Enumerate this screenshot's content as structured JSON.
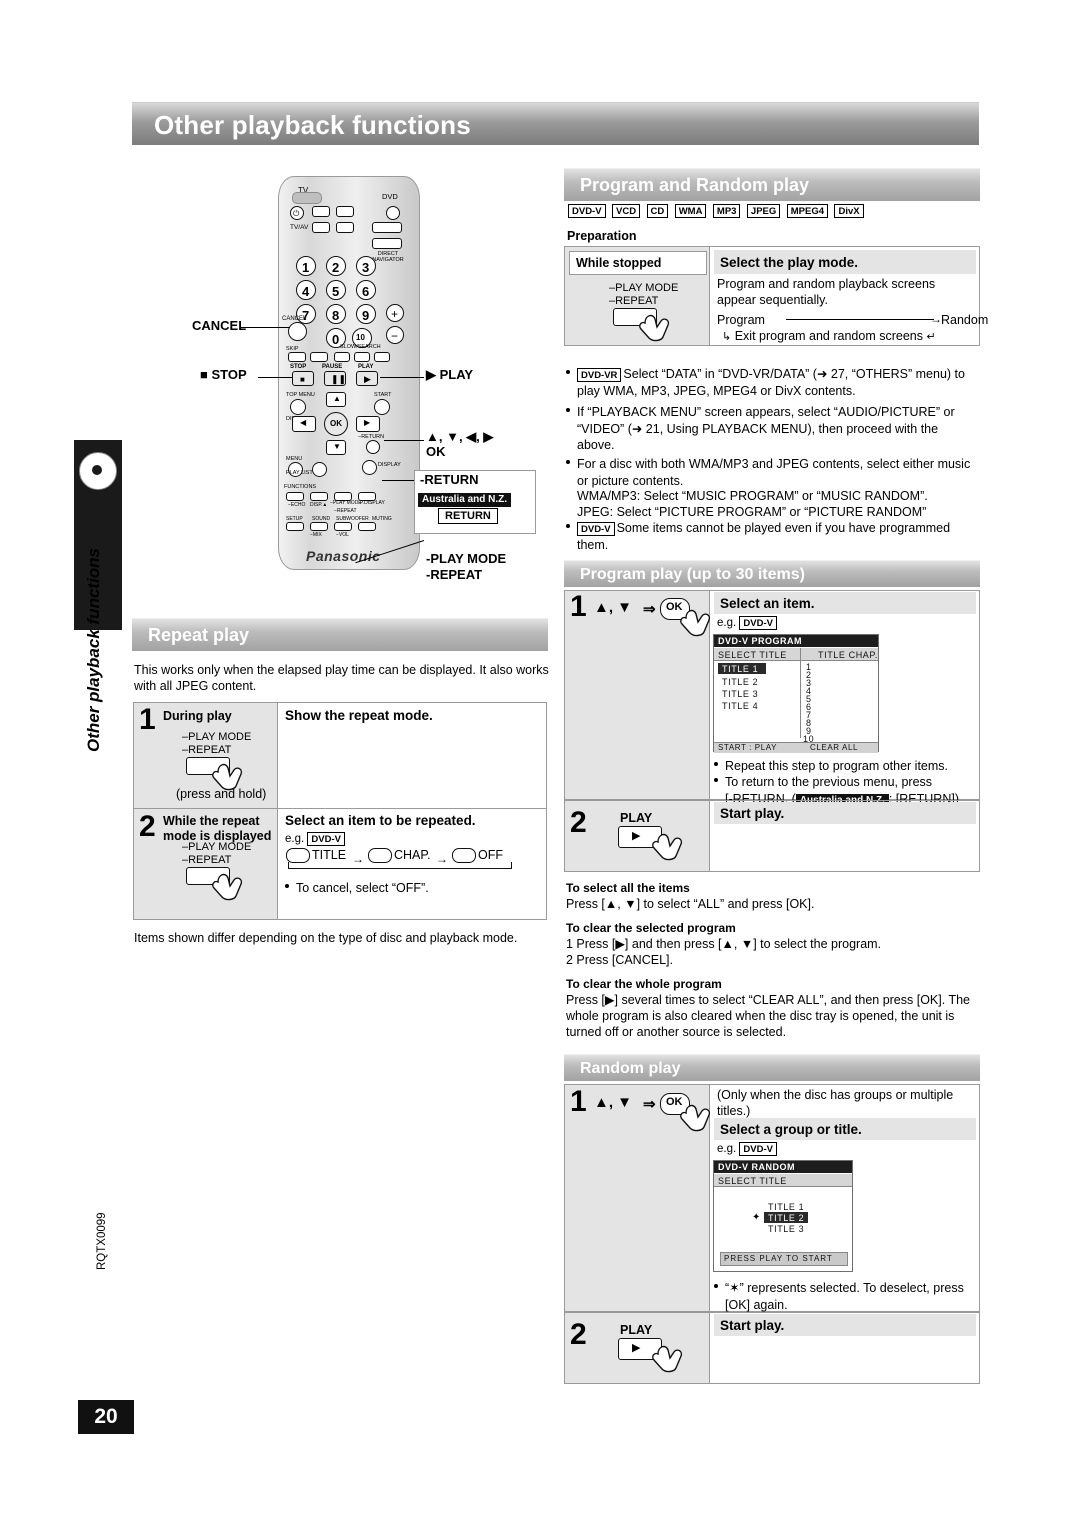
{
  "page": {
    "title": "Other playback functions",
    "side_title": "Other playback functions",
    "page_number": "20",
    "doc_code": "RQTX0099"
  },
  "remote": {
    "brand": "Panasonic",
    "labels": {
      "cancel": "CANCEL",
      "stop": "■ STOP",
      "play": "▶ PLAY",
      "dpad": "▲, ▼, ◀, ▶",
      "ok": "OK",
      "return": "-RETURN",
      "return_region": "Australia and N.Z.",
      "return_btn": "RETURN",
      "play_mode": "-PLAY MODE",
      "repeat": "-REPEAT"
    },
    "keypad": [
      "1",
      "2",
      "3",
      "4",
      "5",
      "6",
      "7",
      "8",
      "9",
      "0"
    ],
    "top_labels": [
      "TV",
      "DVD"
    ],
    "small_labels": [
      "TV/AV",
      "DIRECT NAVIGATOR",
      "TOP MENU",
      "START",
      "MENU",
      "DISPLAY",
      "PLAY LIST",
      "RETURN",
      "SETUP",
      "SOUND",
      "SUBWOOFER",
      "MUTING",
      "FUNCTIONS",
      "ECHO",
      "DISP.▲",
      "PLAY MODE",
      "P.DISPLAY",
      "REPEAT",
      "CANCEL",
      "SKIP",
      "SLOW/SEARCH",
      "STOP",
      "PAUSE",
      "PLAY"
    ]
  },
  "repeat_play": {
    "heading": "Repeat play",
    "intro": "This works only when the elapsed play time can be displayed. It also works with all JPEG content.",
    "steps": [
      {
        "num": "1",
        "cond": "During play",
        "title": "Show the repeat mode.",
        "button_lines": [
          "–PLAY MODE",
          "–REPEAT"
        ],
        "note": "(press and hold)"
      },
      {
        "num": "2",
        "cond_line1": "While the repeat",
        "cond_line2": "mode is displayed",
        "title": "Select an item to be repeated.",
        "button_lines": [
          "–PLAY MODE",
          "–REPEAT"
        ],
        "eg": "e.g.",
        "eg_chip": "DVD-V",
        "cycle": [
          "TITLE",
          "CHAP.",
          "OFF"
        ],
        "bullet": "To cancel, select “OFF”."
      }
    ],
    "footer": "Items shown differ depending on the type of disc and playback mode."
  },
  "program_random": {
    "heading": "Program and Random play",
    "chips": [
      "DVD-V",
      "VCD",
      "CD",
      "WMA",
      "MP3",
      "JPEG",
      "MPEG4",
      "DivX"
    ],
    "preparation_label": "Preparation",
    "prep": {
      "cond": "While stopped",
      "title": "Select the play mode.",
      "desc": "Program and random playback screens appear sequentially.",
      "button_lines": [
        "–PLAY MODE",
        "–REPEAT"
      ],
      "flow_left": "Program",
      "flow_right": "Random",
      "flow_note": "Exit program and random screens"
    },
    "bullets": [
      {
        "chip": "DVD-VR",
        "text": "Select “DATA” in “DVD-VR/DATA” (➜ 27, “OTHERS” menu) to play WMA, MP3, JPEG, MPEG4 or DivX contents."
      },
      {
        "text": "If “PLAYBACK MENU” screen appears, select “AUDIO/PICTURE” or “VIDEO” (➜ 21, Using PLAYBACK MENU), then proceed with the above."
      },
      {
        "text": "For a disc with both WMA/MP3 and JPEG contents, select either music or picture contents.",
        "lines": [
          "WMA/MP3: Select “MUSIC PROGRAM” or “MUSIC RANDOM”.",
          "JPEG: Select “PICTURE PROGRAM” or “PICTURE RANDOM”"
        ]
      },
      {
        "chip": "DVD-V",
        "text": "Some items cannot be played even if you have programmed them."
      }
    ]
  },
  "program_play": {
    "heading": "Program play (up to 30 items)",
    "step1": {
      "num": "1",
      "keys": "▲, ▼",
      "ok": "OK",
      "title": "Select an item.",
      "eg": "e.g.",
      "eg_chip": "DVD-V",
      "bullets": [
        "Repeat this step to program other items.",
        "To return to the previous menu, press [-RETURN. ( Australia and N.Z. : [RETURN])"
      ],
      "bullet2_pre": "To return to the previous menu, press",
      "bullet2_key": "[-RETURN. (",
      "bullet2_region": "Australia and N.Z.",
      "bullet2_post": ": [RETURN])"
    },
    "osd": {
      "titlebar": "DVD-V  PROGRAM",
      "col1": "SELECT TITLE",
      "col2": "TITLE CHAP.",
      "rows": [
        "TITLE 1",
        "TITLE 2",
        "TITLE 3",
        "TITLE 4"
      ],
      "numbers": [
        "1",
        "2",
        "3",
        "4",
        "5",
        "6",
        "7",
        "8",
        "9",
        "10"
      ],
      "footer_left": "START : PLAY",
      "footer_right": "CLEAR ALL"
    },
    "step2": {
      "num": "2",
      "button": "PLAY",
      "title": "Start play."
    },
    "notes": [
      {
        "head": "To select all the items",
        "body": "Press [▲, ▼] to select “ALL” and press [OK]."
      },
      {
        "head": "To clear the selected program",
        "list": [
          "1   Press [▶] and then press [▲, ▼] to select the program.",
          "2   Press [CANCEL]."
        ]
      },
      {
        "head": "To clear the whole program",
        "body": "Press [▶] several times to select “CLEAR ALL”, and then press [OK]. The whole program is also cleared when the disc tray is opened, the unit is turned off or another source is selected."
      }
    ]
  },
  "random_play": {
    "heading": "Random play",
    "step1": {
      "num": "1",
      "keys": "▲, ▼",
      "ok": "OK",
      "note": "(Only when the disc has groups or multiple titles.)",
      "title": "Select a group or title.",
      "eg": "e.g.",
      "eg_chip": "DVD-V"
    },
    "osd": {
      "titlebar": "DVD-V  RANDOM",
      "col1": "SELECT TITLE",
      "rows": [
        "TITLE 1",
        "TITLE 2",
        "TITLE 3"
      ],
      "footer": "PRESS PLAY TO START"
    },
    "bullet": "“✶” represents selected. To deselect, press [OK] again.",
    "step2": {
      "num": "2",
      "button": "PLAY",
      "title": "Start play."
    }
  }
}
